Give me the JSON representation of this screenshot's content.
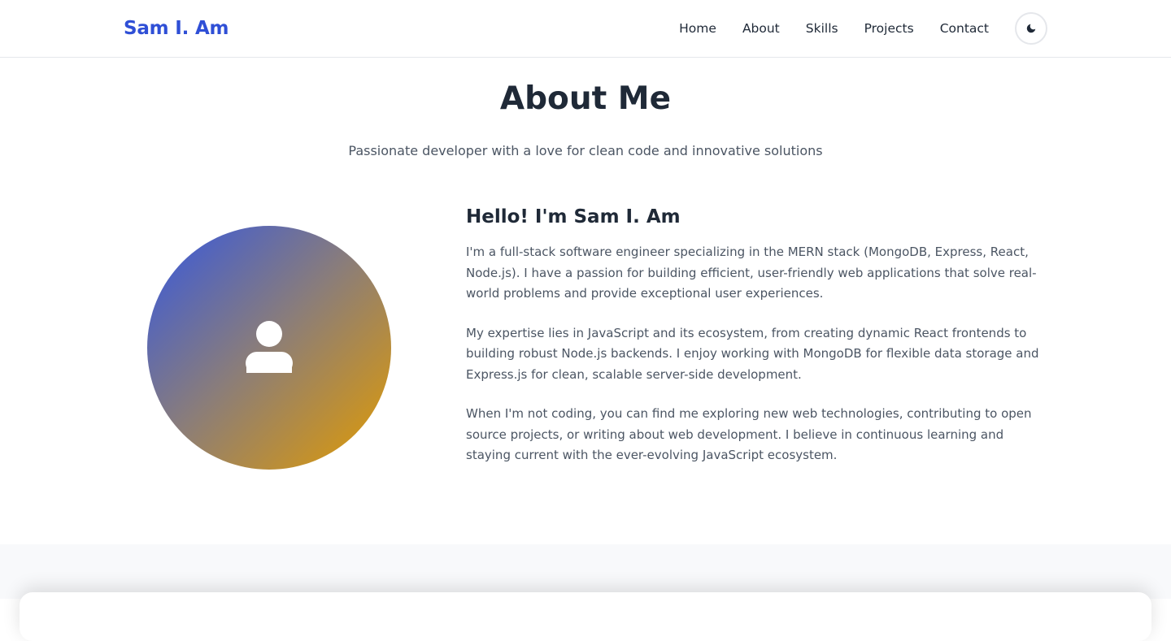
{
  "nav": {
    "brand": "Sam I. Am",
    "links": [
      "Home",
      "About",
      "Skills",
      "Projects",
      "Contact"
    ],
    "theme_toggle_icon": "moon-icon"
  },
  "about": {
    "title": "About Me",
    "subtitle": "Passionate developer with a love for clean code and innovative solutions",
    "avatar_icon": "user-icon",
    "heading": "Hello! I'm Sam I. Am",
    "paragraphs": [
      "I'm a full-stack software engineer specializing in the MERN stack (MongoDB, Express, React, Node.js). I have a passion for building efficient, user-friendly web applications that solve real-world problems and provide exceptional user experiences.",
      "My expertise lies in JavaScript and its ecosystem, from creating dynamic React frontends to building robust Node.js backends. I enjoy working with MongoDB for flexible data storage and Express.js for clean, scalable server-side development.",
      "When I'm not coding, you can find me exploring new web technologies, contributing to open source projects, or writing about web development. I believe in continuous learning and staying current with the ever-evolving JavaScript ecosystem."
    ]
  },
  "colors": {
    "brand": "#2f4fd6",
    "gradient_start": "#3557e0",
    "gradient_end": "#e39c00",
    "text_dark": "#1f2937",
    "text_muted": "#4b5563"
  }
}
